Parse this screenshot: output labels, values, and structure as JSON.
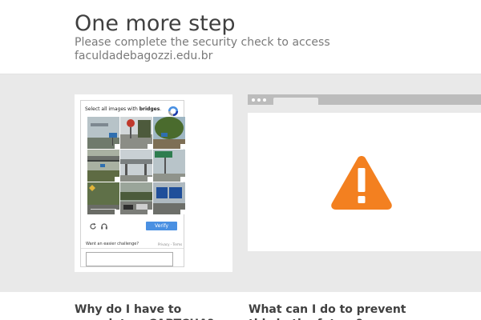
{
  "header": {
    "title": "One more step",
    "subtitle": "Please complete the security check to access faculdadebagozzi.edu.br"
  },
  "captcha": {
    "instruction_prefix": "Select all images with",
    "instruction_keyword": "bridges",
    "instruction_suffix": ".",
    "reload_icon": "reload-icon",
    "audio_icon": "headphones-icon",
    "verify_label": "Verify",
    "easier_link": "Want an easier challenge?",
    "privacy_terms": "Privacy - Terms",
    "answer_value": ""
  },
  "illustration": {
    "icon": "warning-icon",
    "warning_color": "#f38020"
  },
  "faq": {
    "left_heading": "Why do I have to complete a CAPTCHA?",
    "right_heading": "What can I do to prevent this in the future?"
  },
  "colors": {
    "accent": "#4a90e2",
    "band": "#e9e9e9"
  }
}
